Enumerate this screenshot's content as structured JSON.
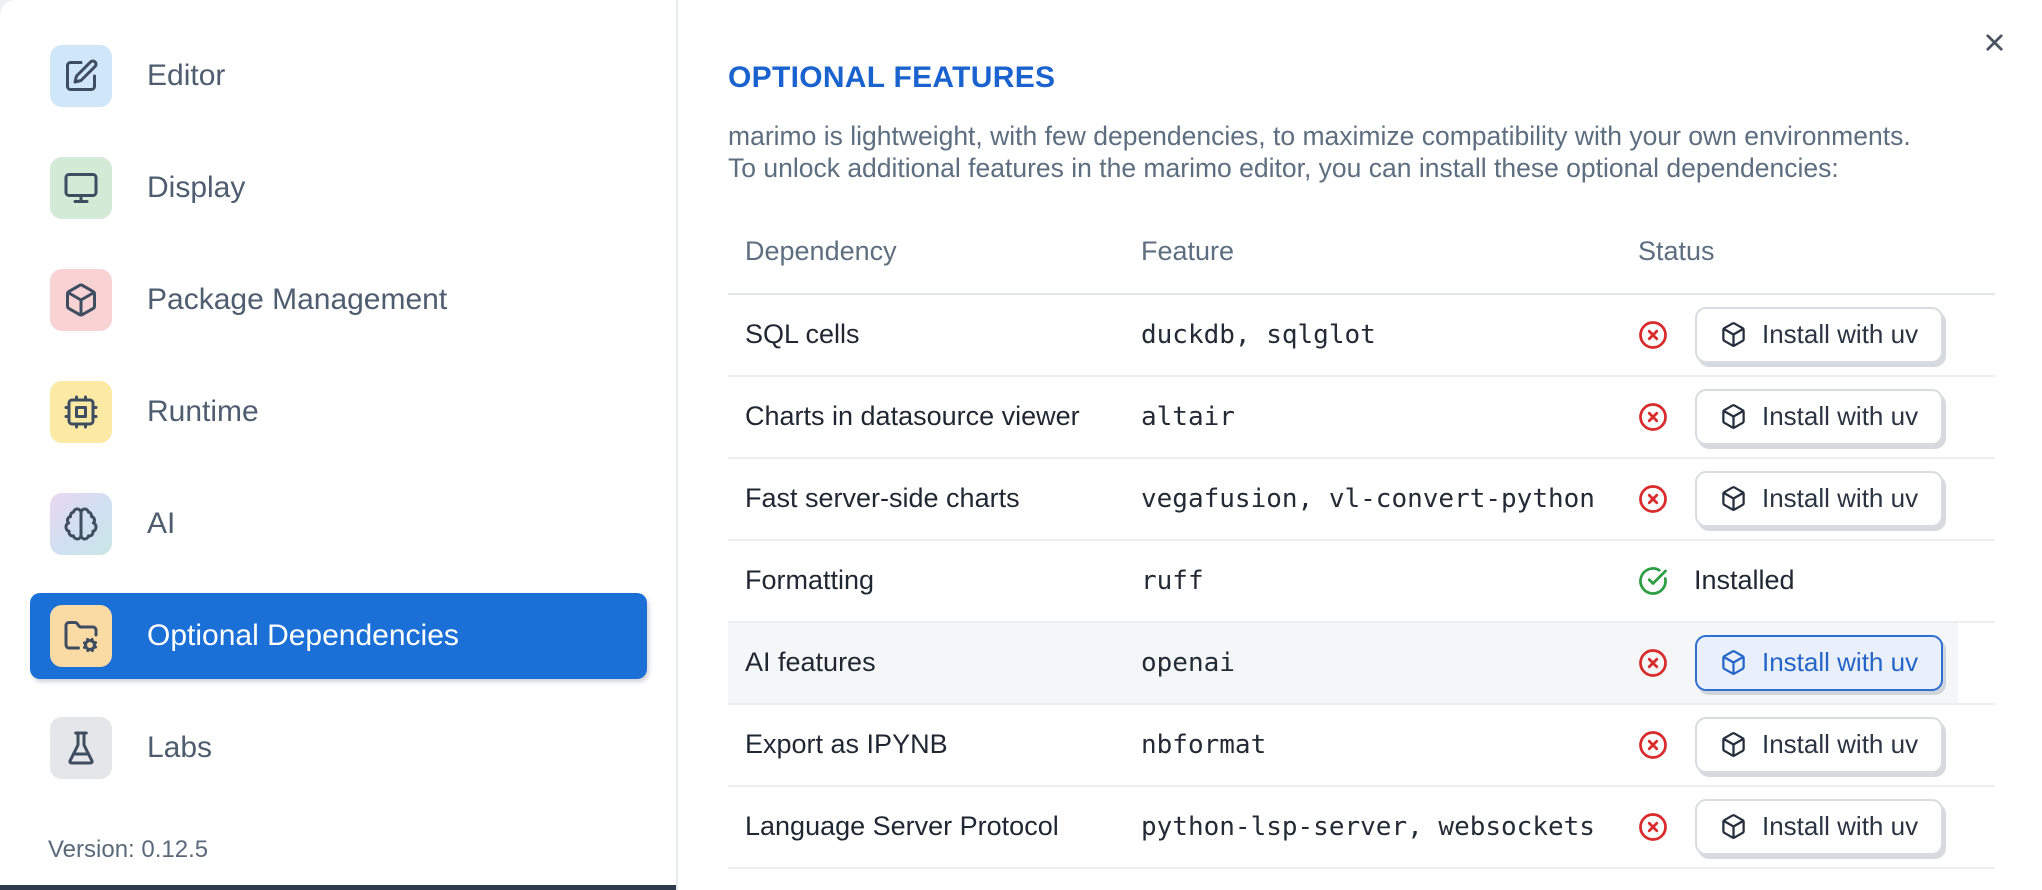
{
  "sidebar": {
    "items": [
      {
        "label": "Editor",
        "icon": "square-pen-icon",
        "tile_bg": "#cfe7f8"
      },
      {
        "label": "Display",
        "icon": "monitor-icon",
        "tile_bg": "#d2ead6"
      },
      {
        "label": "Package Management",
        "icon": "package-icon",
        "tile_bg": "#f9d2d4"
      },
      {
        "label": "Runtime",
        "icon": "cpu-icon",
        "tile_bg": "#fbe9a4"
      },
      {
        "label": "AI",
        "icon": "brain-icon",
        "tile_bg": "linear-gradient(135deg,#ead7f0 0%,#cfe0f2 55%,#c9e5e4 100%)"
      },
      {
        "label": "Optional Dependencies",
        "icon": "folder-cog-icon",
        "tile_bg": "#fbdba4",
        "selected": true
      },
      {
        "label": "Labs",
        "icon": "flask-icon",
        "tile_bg": "#e5e6e9"
      }
    ],
    "selected_bg": "#1b70d7",
    "version_label": "Version: 0.12.5"
  },
  "panel": {
    "title": "OPTIONAL FEATURES",
    "title_color": "#1a63cf",
    "description_line1": "marimo is lightweight, with few dependencies, to maximize compatibility with your own environments.",
    "description_line2": "To unlock additional features in the marimo editor, you can install these optional dependencies:"
  },
  "table": {
    "columns": {
      "dependency": "Dependency",
      "feature": "Feature",
      "status": "Status"
    },
    "installed_label": "Installed",
    "status_colors": {
      "installed_green": "#2e9e44",
      "not_installed_red": "#d92b2b"
    },
    "rows": [
      {
        "dependency": "SQL cells",
        "feature": "duckdb, sqlglot",
        "installed": false,
        "action": "Install with uv"
      },
      {
        "dependency": "Charts in datasource viewer",
        "feature": "altair",
        "installed": false,
        "action": "Install with uv"
      },
      {
        "dependency": "Fast server-side charts",
        "feature": "vegafusion, vl-convert-python",
        "installed": false,
        "action": "Install with uv"
      },
      {
        "dependency": "Formatting",
        "feature": "ruff",
        "installed": true,
        "status_label": "Installed"
      },
      {
        "dependency": "AI features",
        "feature": "openai",
        "installed": false,
        "action": "Install with uv",
        "highlighted": true,
        "button_focused": true
      },
      {
        "dependency": "Export as IPYNB",
        "feature": "nbformat",
        "installed": false,
        "action": "Install with uv"
      },
      {
        "dependency": "Language Server Protocol",
        "feature": "python-lsp-server, websockets",
        "installed": false,
        "action": "Install with uv"
      }
    ]
  }
}
